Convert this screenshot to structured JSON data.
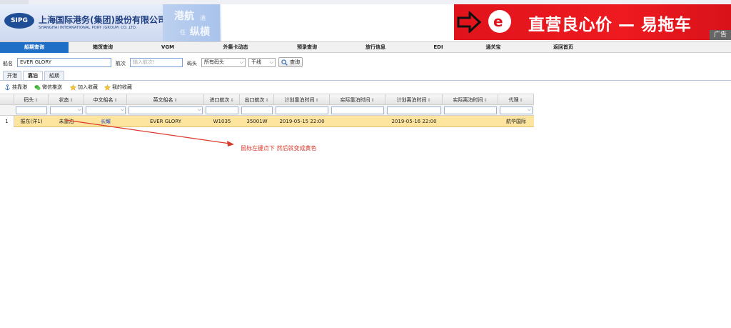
{
  "header": {
    "logo_text": "SIPG",
    "company_cn": "上海国际港务(集团)股份有限公司",
    "company_en": "SHANGHAI INTERNATIONAL PORT (GROUP) CO.,LTD.",
    "slogan_1": "港航",
    "slogan_1_small": "通",
    "slogan_2_small": "任",
    "slogan_2": "纵横"
  },
  "ad": {
    "logo_letter": "e",
    "text": "直营良心价 — 易拖车",
    "label": "广告"
  },
  "nav": {
    "items": [
      "船期查询",
      "箱货查询",
      "VGM",
      "外集卡动态",
      "预录查询",
      "放行信息",
      "EDI",
      "通关宝",
      "返回首页"
    ],
    "active_index": 0
  },
  "search": {
    "ship_name_label": "船名",
    "ship_name_value": "EVER GLORY",
    "voyage_label": "航次",
    "voyage_placeholder": "输入航次!",
    "terminal_label": "码头",
    "terminal_select": "所有码头",
    "route_select": "干线",
    "query_button": "查询"
  },
  "tabs": {
    "items": [
      "开港",
      "靠泊",
      "船期"
    ],
    "active_index": 1
  },
  "toolbar": {
    "berth_port": "挂靠港",
    "wechat_push": "微信推送",
    "add_favorite": "加入收藏",
    "my_favorite": "我的收藏"
  },
  "grid": {
    "columns": [
      "码头",
      "状态",
      "中文船名",
      "英文船名",
      "进口航次",
      "出口航次",
      "计划靠泊时间",
      "实际靠泊时间",
      "计划离泊时间",
      "实际离泊时间",
      "代理"
    ],
    "rows": [
      {
        "row_num": "1",
        "terminal": "振东(洋1)",
        "status": "未靠泊",
        "cn_name": "长耀",
        "en_name": "EVER GLORY",
        "import_voyage": "W1035",
        "export_voyage": "35001W",
        "planned_berth": "2019-05-15 22:00",
        "actual_berth": "",
        "planned_depart": "2019-05-16 22:00",
        "actual_depart": "",
        "agent": "航华国际"
      }
    ]
  },
  "annotation": {
    "text": "鼠标左键点下  然后就变成黄色",
    "color": "#d93a2b"
  },
  "colors": {
    "nav_active": "#1f6fc6",
    "row_highlight": "#fde59f",
    "ad_red": "#e0131c"
  }
}
